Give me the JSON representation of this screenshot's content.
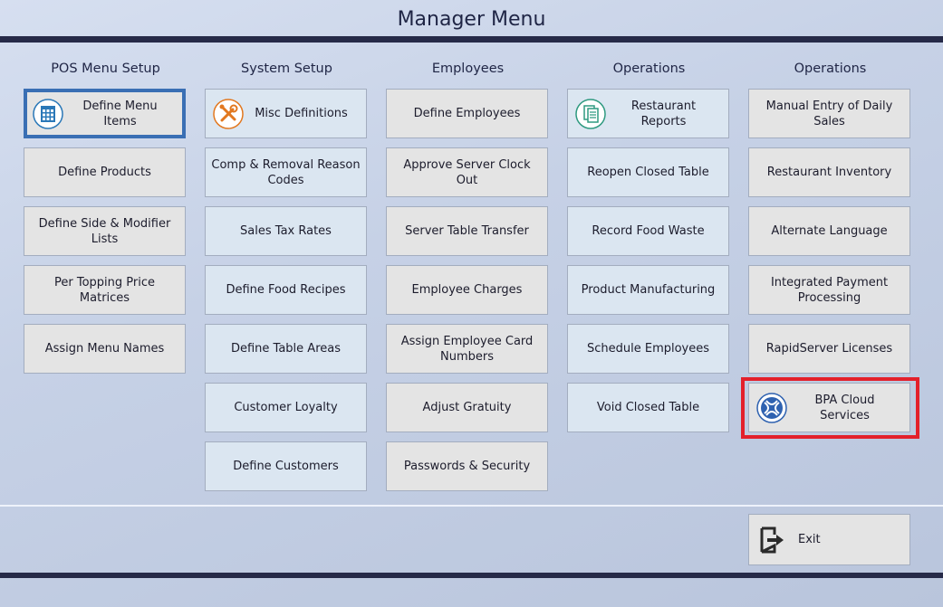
{
  "title": "Manager Menu",
  "columns": [
    {
      "heading": "POS Menu Setup",
      "buttons": [
        {
          "label": "Define Menu Items",
          "icon": "calendar-grid-icon"
        },
        {
          "label": "Define Products"
        },
        {
          "label": "Define Side & Modifier Lists"
        },
        {
          "label": "Per Topping Price Matrices"
        },
        {
          "label": "Assign Menu Names"
        }
      ]
    },
    {
      "heading": "System Setup",
      "buttons": [
        {
          "label": "Misc Definitions",
          "icon": "tools-icon"
        },
        {
          "label": "Comp & Removal Reason Codes"
        },
        {
          "label": "Sales Tax Rates"
        },
        {
          "label": "Define Food Recipes"
        },
        {
          "label": "Define Table Areas"
        },
        {
          "label": "Customer Loyalty"
        },
        {
          "label": "Define Customers"
        }
      ]
    },
    {
      "heading": "Employees",
      "buttons": [
        {
          "label": "Define Employees"
        },
        {
          "label": "Approve Server Clock Out"
        },
        {
          "label": "Server Table Transfer"
        },
        {
          "label": "Employee Charges"
        },
        {
          "label": "Assign Employee Card Numbers"
        },
        {
          "label": "Adjust Gratuity"
        },
        {
          "label": "Passwords & Security"
        }
      ]
    },
    {
      "heading": "Operations",
      "buttons": [
        {
          "label": "Restaurant Reports",
          "icon": "reports-icon"
        },
        {
          "label": "Reopen Closed Table"
        },
        {
          "label": "Record Food Waste"
        },
        {
          "label": "Product Manufacturing"
        },
        {
          "label": "Schedule Employees"
        },
        {
          "label": "Void Closed Table"
        }
      ]
    },
    {
      "heading": "Operations",
      "buttons": [
        {
          "label": "Manual Entry of Daily Sales"
        },
        {
          "label": "Restaurant Inventory"
        },
        {
          "label": "Alternate Language"
        },
        {
          "label": "Integrated Payment Processing"
        },
        {
          "label": "RapidServer Licenses"
        },
        {
          "label": "BPA Cloud Services",
          "icon": "cloud-services-icon"
        }
      ]
    }
  ],
  "exit": {
    "label": "Exit",
    "icon": "exit-icon"
  },
  "colors": {
    "bar": "#262a48",
    "button_gray": "#e4e4e4",
    "button_blue": "#dbe6f1",
    "highlight": "#e3202b",
    "selected_outline": "#3a6fb4"
  }
}
